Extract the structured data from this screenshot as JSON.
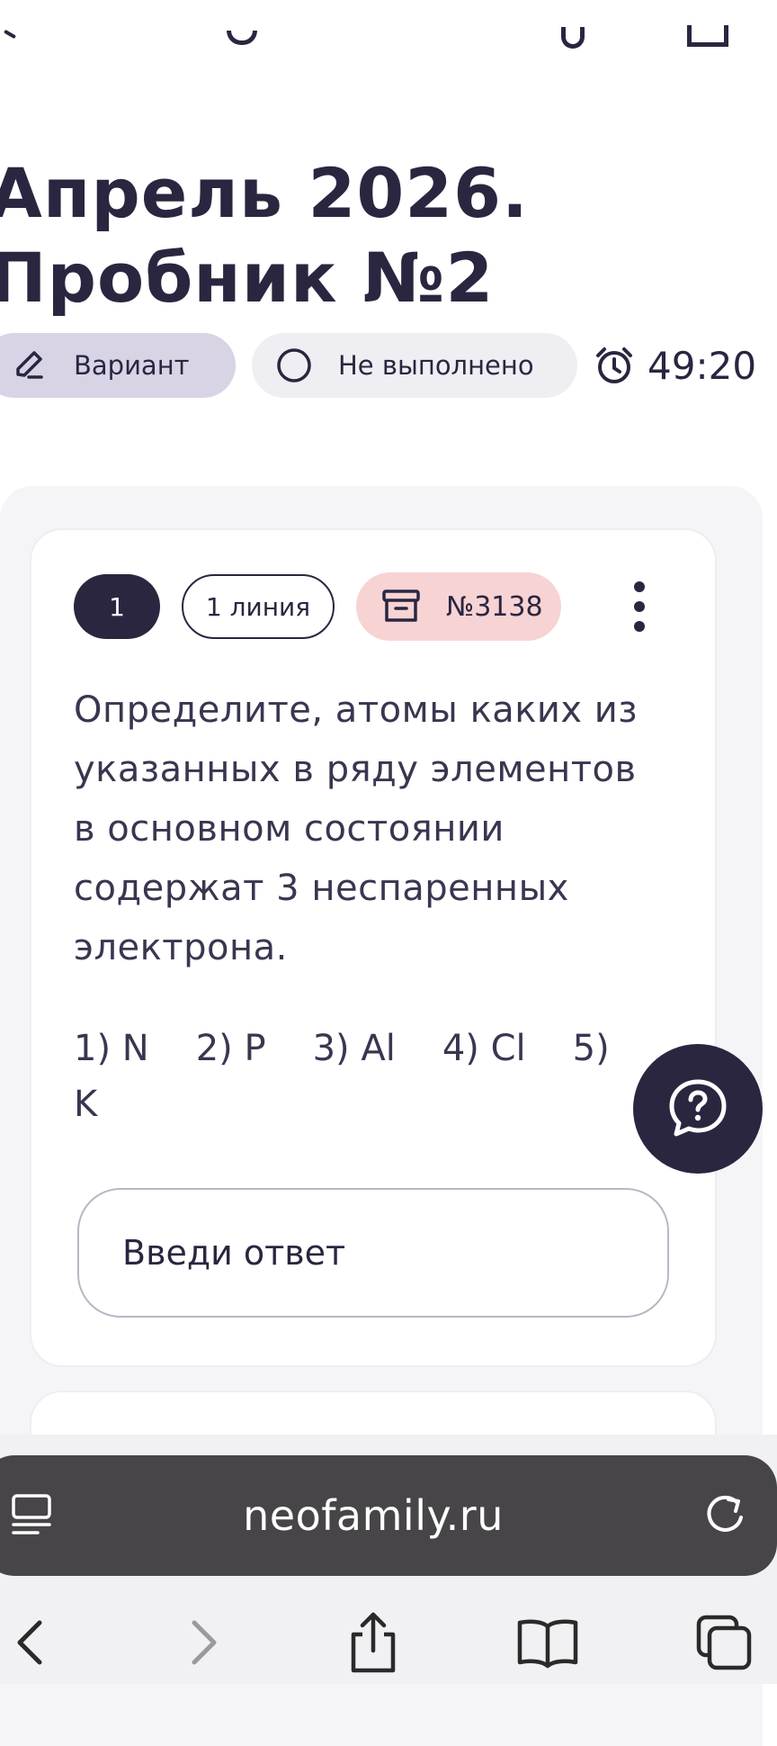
{
  "page": {
    "title": "Апрель 2026.\nПробник №2"
  },
  "meta": {
    "variant_label": "Вариант",
    "status_label": "Не выполнено",
    "timer": "49:20"
  },
  "task": {
    "number": "1",
    "line": "1 линия",
    "id": "№3138",
    "question": "Определите, атомы каких из указанных в ряду элементов в основном состоянии содержат 3 неспаренных электрона.",
    "options": [
      "1) N",
      "2) P",
      "3) Al",
      "4) Cl",
      "5) K"
    ],
    "answer_placeholder": "Введи ответ"
  },
  "browser": {
    "url": "neofamily.ru"
  },
  "colors": {
    "primary": "#2a2640",
    "variant_bg": "#d8d4e6",
    "status_bg": "#efeef2",
    "id_badge_bg": "#f7d3d4",
    "panel_bg": "#f5f5f8"
  }
}
